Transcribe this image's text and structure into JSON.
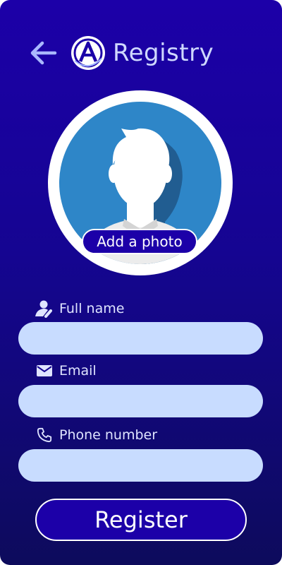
{
  "header": {
    "title": "Registry",
    "back_icon": "arrow-left-icon",
    "logo_icon": "registry-logo-icon"
  },
  "avatar": {
    "icon": "user-silhouette-icon",
    "add_photo_label": "Add a photo"
  },
  "form": {
    "fields": [
      {
        "label": "Full name",
        "icon": "user-icon",
        "value": "",
        "placeholder": ""
      },
      {
        "label": "Email",
        "icon": "envelope-icon",
        "value": "",
        "placeholder": ""
      },
      {
        "label": "Phone number",
        "icon": "phone-icon",
        "value": "",
        "placeholder": ""
      }
    ],
    "submit_label": "Register"
  },
  "colors": {
    "background_top": "#1c00a8",
    "background_bottom": "#0d0b5c",
    "input_fill": "#c8dcff",
    "avatar_fill": "#2e86c8",
    "accent": "#1c00a8"
  }
}
